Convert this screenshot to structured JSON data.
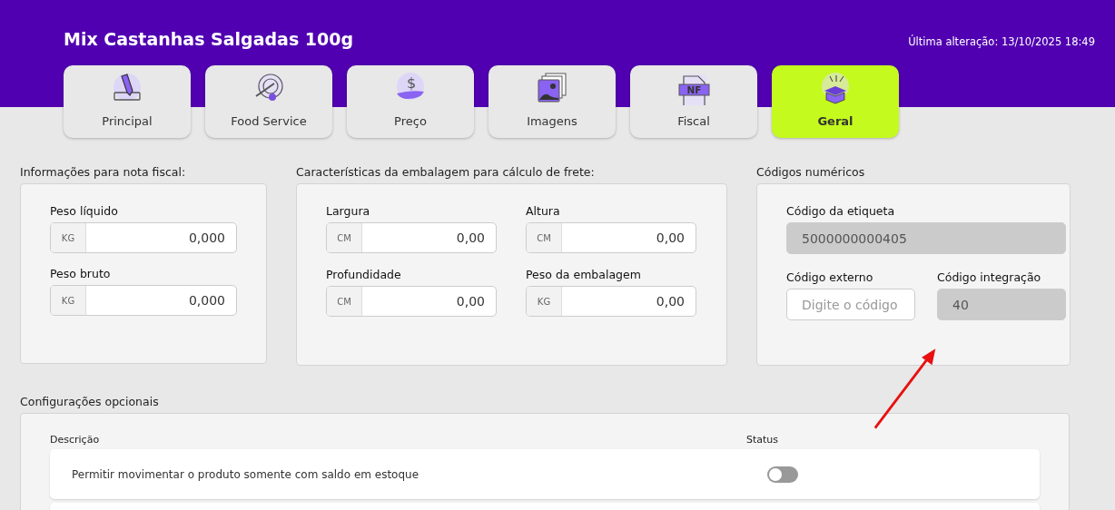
{
  "header": {
    "title": "Mix Castanhas Salgadas 100g",
    "last_modified": "Última alteração: 13/10/2025 18:49"
  },
  "tabs": [
    {
      "label": "Principal",
      "selected": false
    },
    {
      "label": "Food Service",
      "selected": false
    },
    {
      "label": "Preço",
      "selected": false,
      "icon_text": "$"
    },
    {
      "label": "Imagens",
      "selected": false
    },
    {
      "label": "Fiscal",
      "selected": false,
      "icon_text": "NF"
    },
    {
      "label": "Geral",
      "selected": true
    }
  ],
  "nota_fiscal": {
    "title": "Informações para nota fiscal:",
    "fields": [
      {
        "label": "Peso líquido",
        "unit": "KG",
        "value": "0,000"
      },
      {
        "label": "Peso bruto",
        "unit": "KG",
        "value": "0,000"
      }
    ]
  },
  "embalagem": {
    "title": "Características da embalagem para cálculo de frete:",
    "fields": [
      {
        "label": "Largura",
        "unit": "CM",
        "value": "0,00"
      },
      {
        "label": "Altura",
        "unit": "CM",
        "value": "0,00"
      },
      {
        "label": "Profundidade",
        "unit": "CM",
        "value": "0,00"
      },
      {
        "label": "Peso da embalagem",
        "unit": "KG",
        "value": "0,00"
      }
    ]
  },
  "codigos": {
    "title": "Códigos numéricos",
    "etiqueta": {
      "label": "Código da etiqueta",
      "value": "5000000000405",
      "disabled": true
    },
    "externo": {
      "label": "Código externo",
      "placeholder": "Digite o código",
      "disabled": false
    },
    "integracao": {
      "label": "Código integração",
      "value": "40",
      "disabled": true
    }
  },
  "config": {
    "title": "Configurações opcionais",
    "columns": [
      "Descrição",
      "Status"
    ],
    "rows": [
      {
        "description": "Permitir movimentar o produto somente com saldo em estoque",
        "on": false
      }
    ]
  }
}
